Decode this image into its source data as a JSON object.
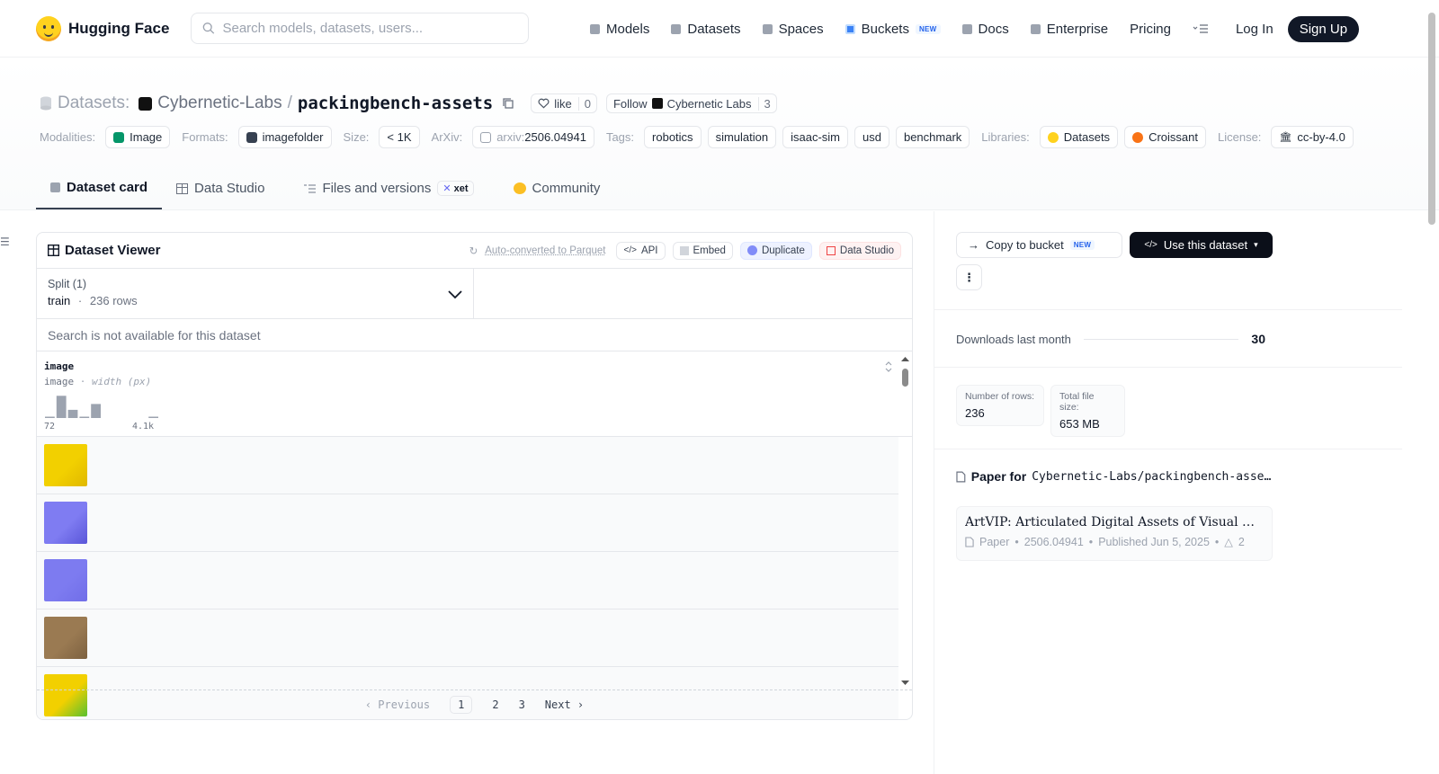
{
  "header": {
    "brand": "Hugging Face",
    "search_placeholder": "Search models, datasets, users...",
    "nav": [
      {
        "label": "Models",
        "icon": "cube-icon"
      },
      {
        "label": "Datasets",
        "icon": "database-icon"
      },
      {
        "label": "Spaces",
        "icon": "grid-icon"
      },
      {
        "label": "Buckets",
        "icon": "bucket-icon",
        "badge": "NEW"
      },
      {
        "label": "Docs",
        "icon": "book-icon"
      },
      {
        "label": "Enterprise",
        "icon": "enterprise-icon"
      },
      {
        "label": "Pricing"
      }
    ],
    "login": "Log In",
    "signup": "Sign Up"
  },
  "repo": {
    "type_label": "Datasets:",
    "owner": "Cybernetic-Labs",
    "separator": "/",
    "name": "packingbench-assets",
    "like_label": "like",
    "like_count": "0",
    "follow_label": "Follow",
    "follow_org": "Cybernetic Labs",
    "follow_count": "3"
  },
  "meta": {
    "modalities_label": "Modalities:",
    "modality": "Image",
    "formats_label": "Formats:",
    "format": "imagefolder",
    "size_label": "Size:",
    "size": "< 1K",
    "arxiv_label": "ArXiv:",
    "arxiv_prefix": "arxiv:",
    "arxiv": "2506.04941",
    "tags_label": "Tags:",
    "tags": [
      "robotics",
      "simulation",
      "isaac-sim",
      "usd",
      "benchmark"
    ],
    "libraries_label": "Libraries:",
    "libraries": [
      "Datasets",
      "Croissant"
    ],
    "license_label": "License:",
    "license": "cc-by-4.0"
  },
  "tabs": [
    {
      "label": "Dataset card",
      "active": true
    },
    {
      "label": "Data Studio"
    },
    {
      "label": "Files and versions",
      "badge": "xet"
    },
    {
      "label": "Community"
    }
  ],
  "viewer": {
    "title": "Dataset Viewer",
    "auto_converted": "Auto-converted to Parquet",
    "api": "API",
    "embed": "Embed",
    "duplicate": "Duplicate",
    "data_studio": "Data Studio",
    "split_label": "Split (1)",
    "split_name": "train",
    "split_sep": "·",
    "split_rows": "236 rows",
    "search_na": "Search is not available for this dataset",
    "column_name": "image",
    "column_type": "image",
    "column_type_sep": "·",
    "column_stat": "width (px)",
    "hist_min": "72",
    "hist_max": "4.1k",
    "histogram": [
      0.05,
      0.95,
      0.35,
      0.05,
      0.6,
      0.0,
      0.0,
      0.0,
      0.0,
      0.05
    ],
    "rows": [
      {
        "color_a": "#f2d000",
        "color_b": "#e0b800"
      },
      {
        "color_a": "#7f7cf2",
        "color_b": "#5a56d8"
      },
      {
        "color_a": "#7d7bf0",
        "color_b": "#716ee8"
      },
      {
        "color_a": "#9a7a52",
        "color_b": "#7d6140"
      },
      {
        "color_a": "#f2d000",
        "color_b": "#58c030"
      }
    ],
    "pager": {
      "prev": "Previous",
      "pages": [
        "1",
        "2",
        "3"
      ],
      "current": "1",
      "next": "Next"
    }
  },
  "sidebar": {
    "copy_bucket": "Copy to bucket",
    "copy_badge": "NEW",
    "use_dataset": "Use this dataset",
    "downloads_label": "Downloads last month",
    "downloads": "30",
    "rows_label": "Number of rows:",
    "rows": "236",
    "size_label": "Total file size:",
    "size": "653 MB",
    "paper_for": "Paper for",
    "paper_repo": "Cybernetic-Labs/packingbench-assets",
    "paper_title": "ArtVIP: Articulated Digital Assets of Visual Realism, Modular Interaction, and Physical Fidelity for Robot Learning",
    "paper_kind": "Paper",
    "paper_id": "2506.04941",
    "paper_date": "Published Jun 5, 2025",
    "paper_upvotes": "2",
    "dot": "•"
  },
  "colors": {
    "accent": "#111827",
    "brand_yellow": "#ffd21e"
  }
}
